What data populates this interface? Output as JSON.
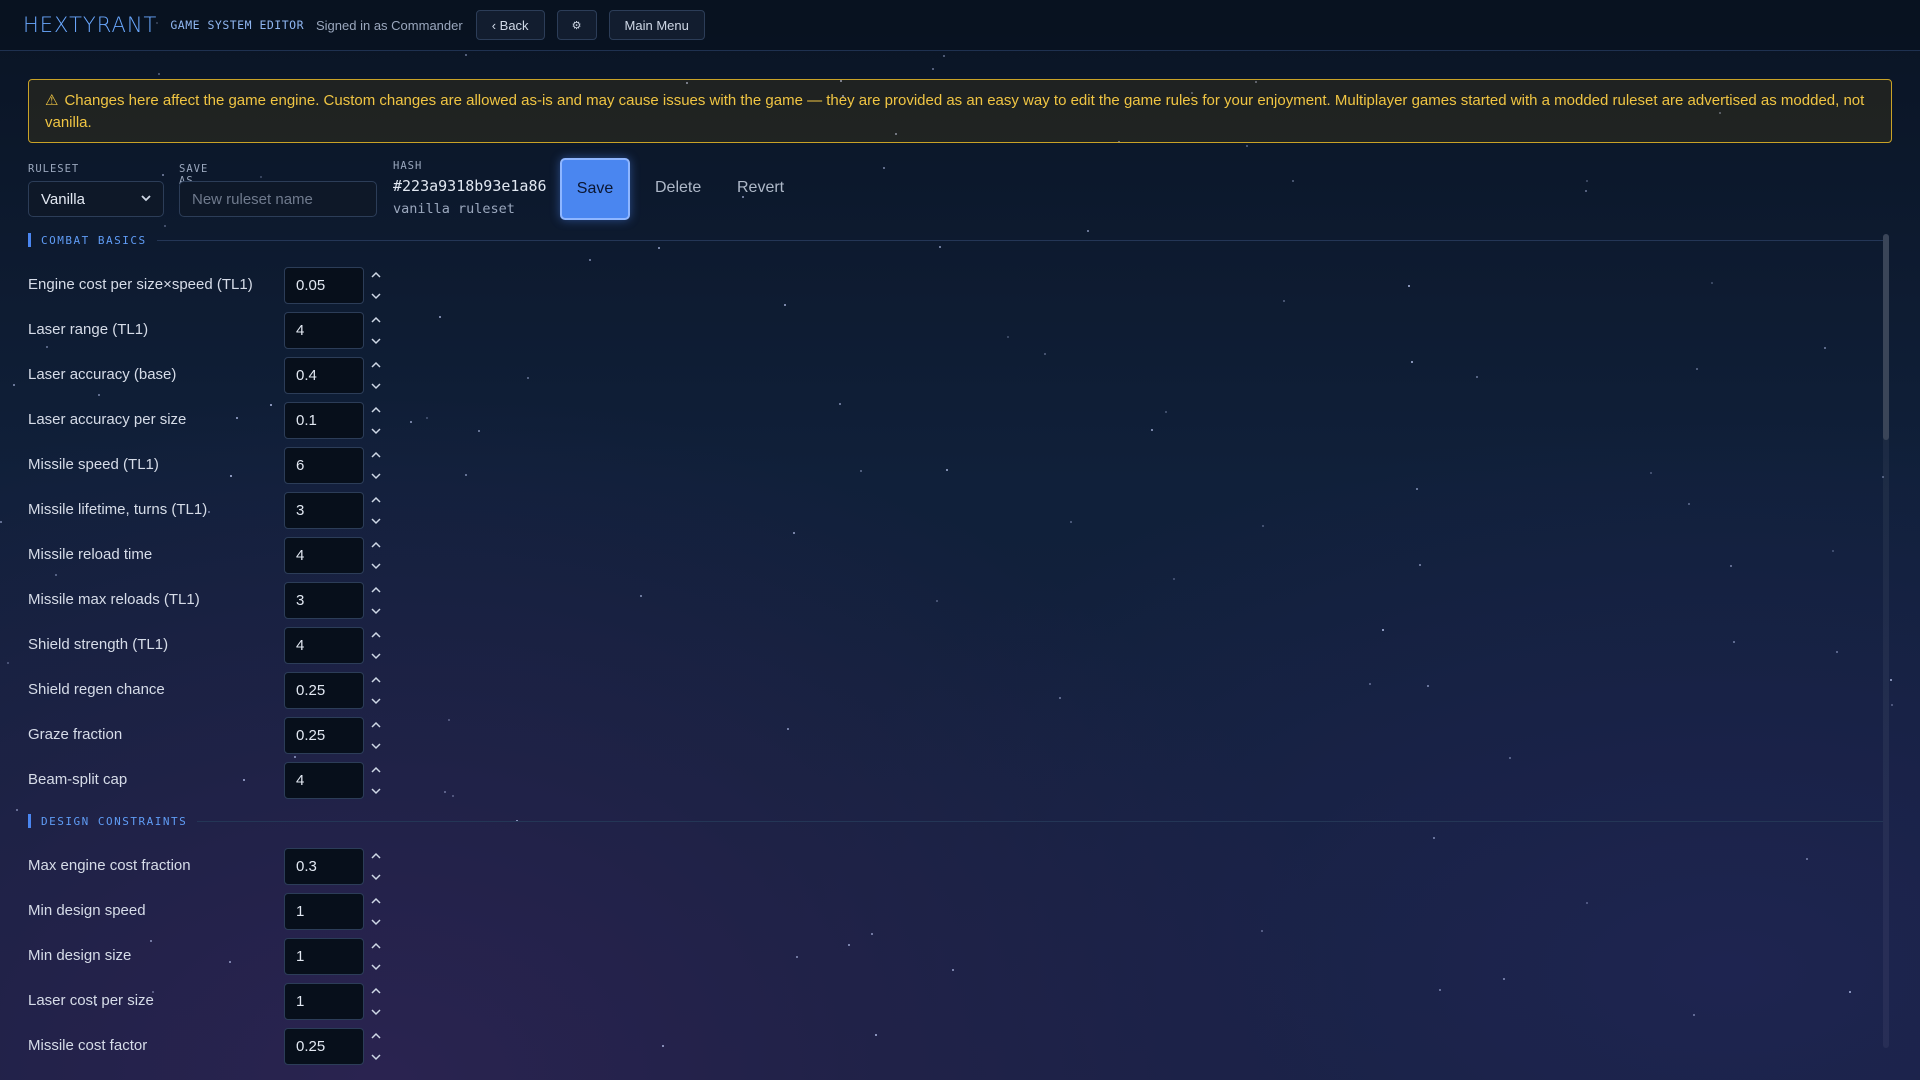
{
  "app": {
    "logo": "HEXTYRANT",
    "subtitle": "GAME SYSTEM EDITOR",
    "signed_in": "Signed in as Commander"
  },
  "topbar": {
    "back_label": "‹ Back",
    "settings_icon": "⚙",
    "main_menu_label": "Main Menu"
  },
  "warning": {
    "icon": "⚠",
    "text": "Changes here affect the game engine. Custom changes are allowed as-is and may cause issues with the game — they are provided as an easy way to edit the game rules for your enjoyment. Multiplayer games started with a modded ruleset are advertised as modded, not vanilla."
  },
  "controls": {
    "ruleset_label": "RULESET",
    "ruleset_value": "Vanilla",
    "save_as_label": "SAVE AS",
    "save_as_placeholder": "New ruleset name",
    "hash_label": "HASH",
    "hash_value": "#223a9318b93e1a86",
    "hash_sub": "vanilla ruleset",
    "save_label": "Save",
    "delete_label": "Delete",
    "revert_label": "Revert"
  },
  "sections": [
    {
      "title": "COMBAT BASICS",
      "fields": [
        {
          "label": "Engine cost per size×speed (TL1)",
          "value": "0.05"
        },
        {
          "label": "Laser range (TL1)",
          "value": "4"
        },
        {
          "label": "Laser accuracy (base)",
          "value": "0.4"
        },
        {
          "label": "Laser accuracy per size",
          "value": "0.1"
        },
        {
          "label": "Missile speed (TL1)",
          "value": "6"
        },
        {
          "label": "Missile lifetime, turns (TL1)",
          "value": "3"
        },
        {
          "label": "Missile reload time",
          "value": "4"
        },
        {
          "label": "Missile max reloads (TL1)",
          "value": "3"
        },
        {
          "label": "Shield strength (TL1)",
          "value": "4"
        },
        {
          "label": "Shield regen chance",
          "value": "0.25"
        },
        {
          "label": "Graze fraction",
          "value": "0.25"
        },
        {
          "label": "Beam-split cap",
          "value": "4"
        }
      ]
    },
    {
      "title": "DESIGN CONSTRAINTS",
      "fields": [
        {
          "label": "Max engine cost fraction",
          "value": "0.3"
        },
        {
          "label": "Min design speed",
          "value": "1"
        },
        {
          "label": "Min design size",
          "value": "1"
        },
        {
          "label": "Laser cost per size",
          "value": "1"
        },
        {
          "label": "Missile cost factor",
          "value": "0.25"
        }
      ]
    }
  ],
  "colors": {
    "accent": "#4a86f0",
    "warning": "#f0c543",
    "logo": "#6aa8ff"
  }
}
